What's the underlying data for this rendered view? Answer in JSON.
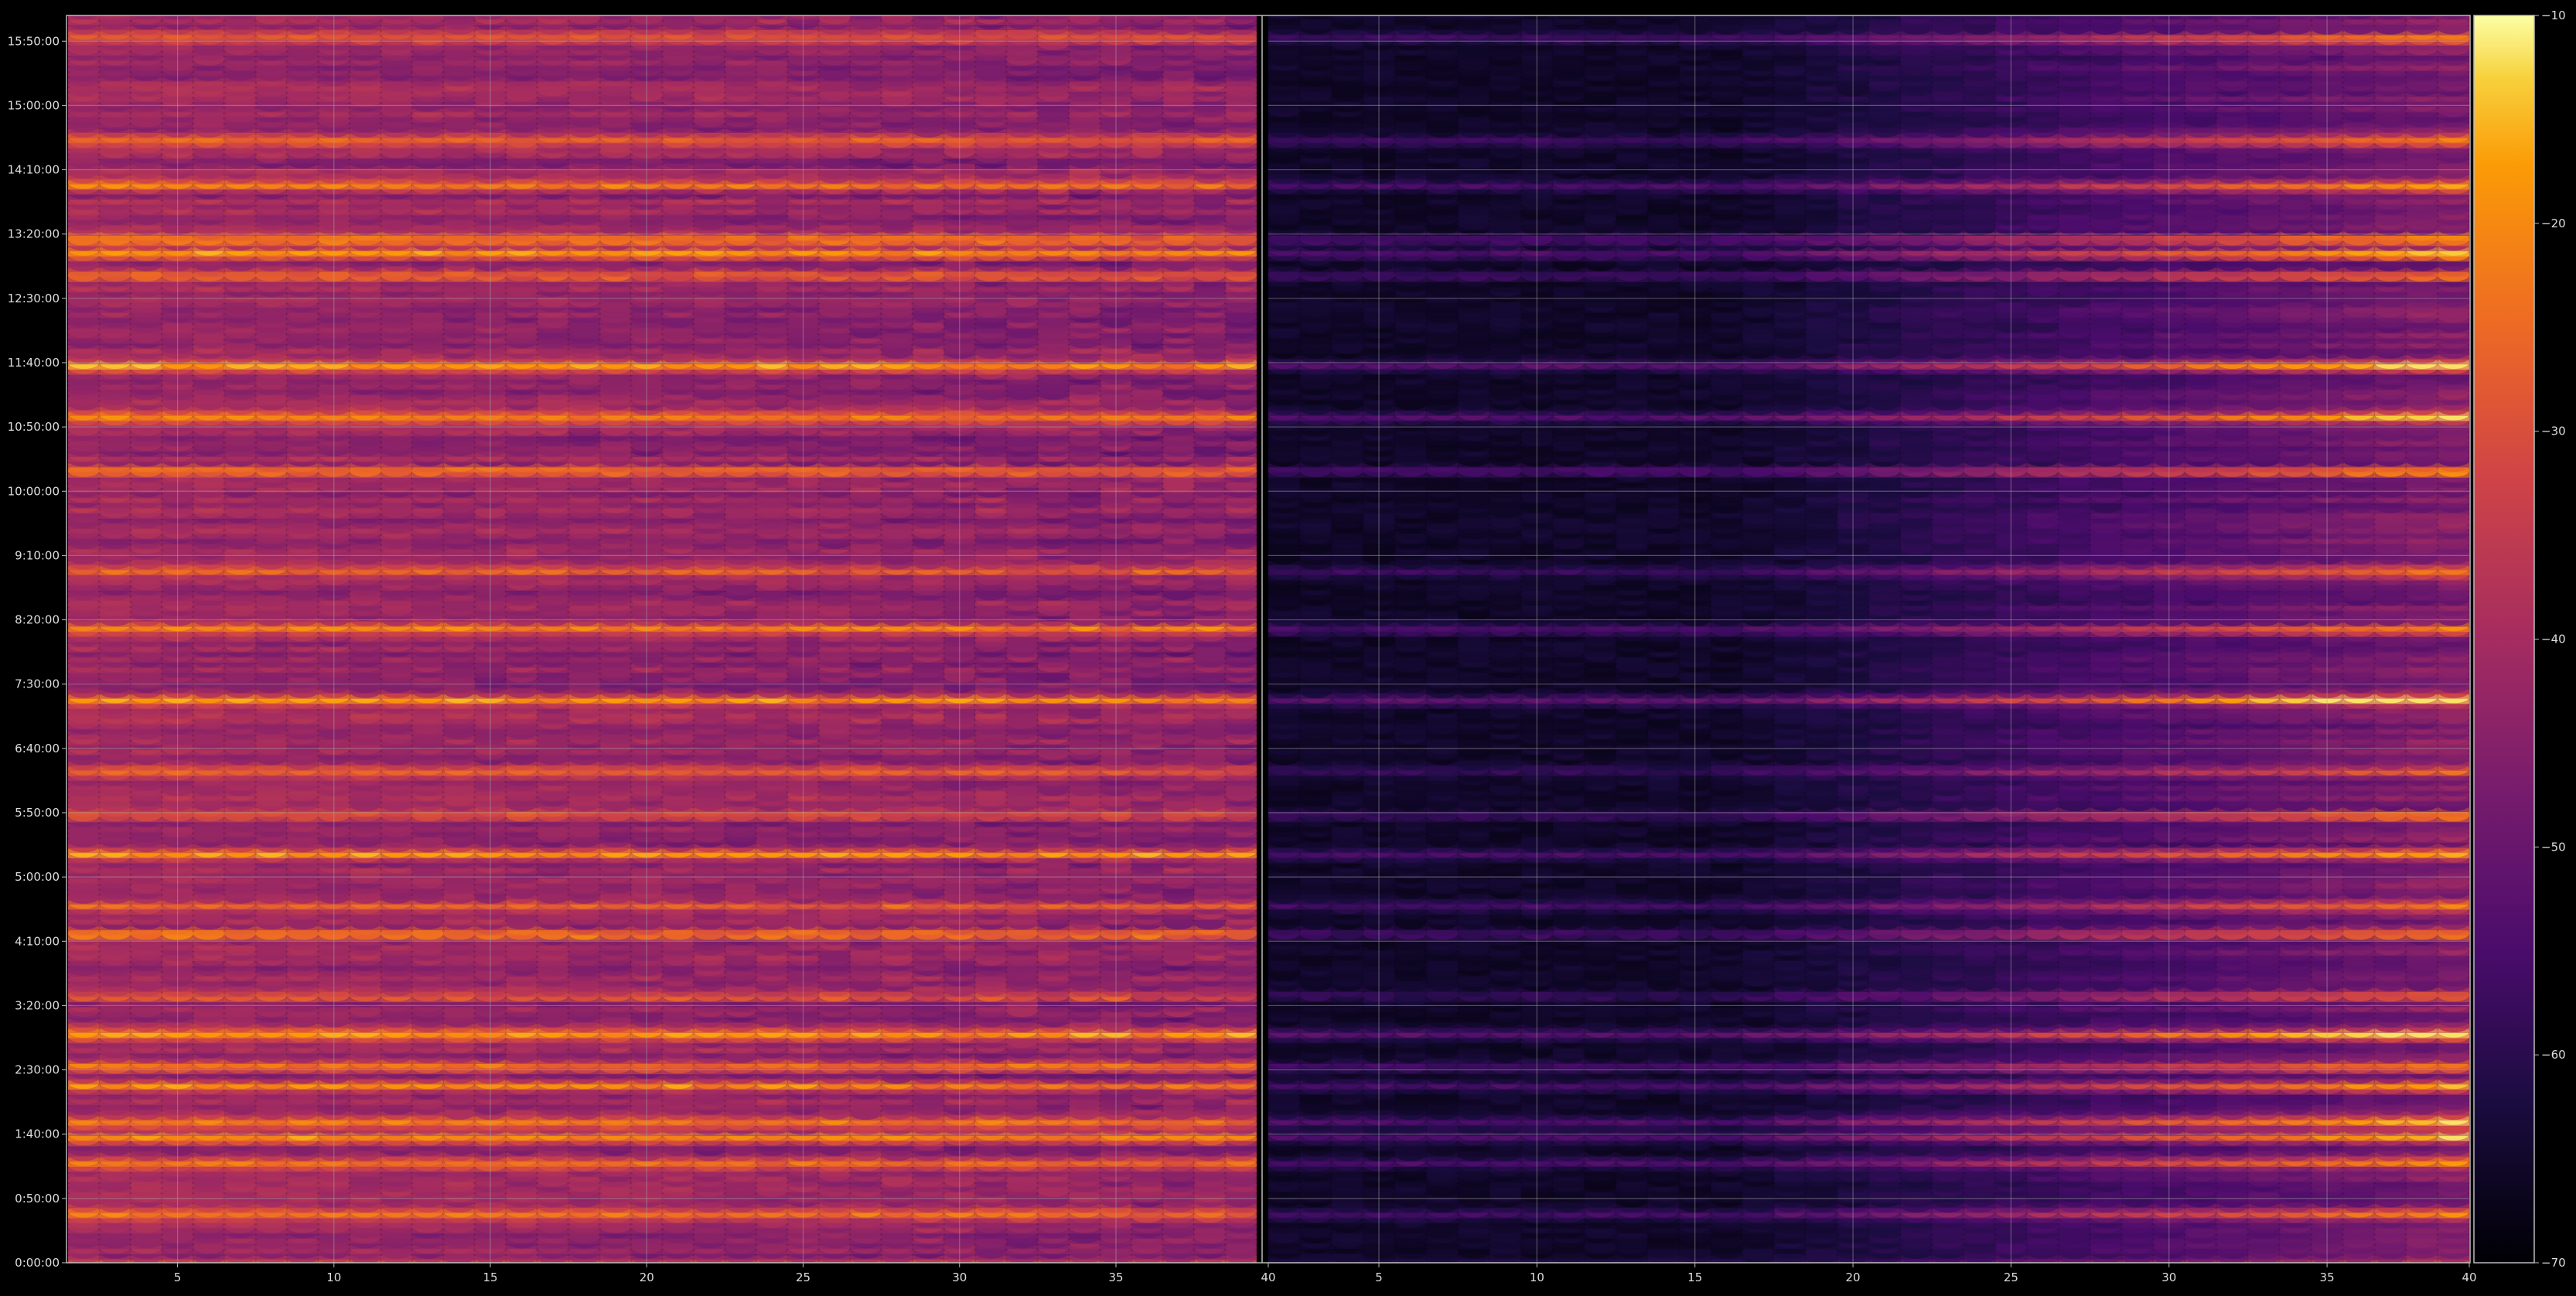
{
  "chart_data": {
    "type": "heatmap",
    "colormap": "inferno",
    "background": "#000000",
    "text_color": "#dddddd",
    "grid": true,
    "panels": [
      {
        "name": "left",
        "x_range": [
          1.5,
          39.5
        ],
        "x_ticks": [
          5,
          10,
          15,
          20,
          25,
          30,
          35
        ]
      },
      {
        "name": "right",
        "x_range": [
          1.5,
          39.5
        ],
        "x_ticks": [
          5,
          10,
          15,
          20,
          25,
          30,
          35
        ],
        "x_tick_labels": [
          "40",
          "5",
          "10",
          "15",
          "20",
          "25",
          "30",
          "35",
          "40"
        ]
      }
    ],
    "y_axis": {
      "unit": "minutes",
      "range_minutes": [
        0,
        970
      ],
      "tick_minutes": [
        0,
        50,
        100,
        150,
        200,
        250,
        300,
        350,
        400,
        450,
        500,
        550,
        600,
        650,
        700,
        750,
        800,
        850,
        900,
        950
      ],
      "tick_labels": [
        "0:00:00",
        "0:50:00",
        "1:40:00",
        "2:30:00",
        "3:20:00",
        "4:10:00",
        "5:00:00",
        "5:50:00",
        "6:40:00",
        "7:30:00",
        "8:20:00",
        "9:10:00",
        "10:00:00",
        "10:50:00",
        "11:40:00",
        "12:30:00",
        "13:20:00",
        "14:10:00",
        "15:00:00",
        "15:50:00"
      ]
    },
    "colorbar": {
      "vmin": -70,
      "vmax": -10,
      "ticks": [
        -70,
        -60,
        -50,
        -40,
        -30,
        -20,
        -10
      ],
      "tick_labels": [
        "−70",
        "−60",
        "−50",
        "−40",
        "−30",
        "−20",
        "−10"
      ]
    },
    "bright_bands_minutes": [
      {
        "t": 0,
        "level": 0.55
      },
      {
        "t": 40,
        "level": 0.62
      },
      {
        "t": 80,
        "level": 0.72
      },
      {
        "t": 100,
        "level": 0.74
      },
      {
        "t": 112,
        "level": 0.76
      },
      {
        "t": 140,
        "level": 0.66
      },
      {
        "t": 155,
        "level": 0.7
      },
      {
        "t": 180,
        "level": 0.85
      },
      {
        "t": 210,
        "level": 0.55
      },
      {
        "t": 258,
        "level": 0.74
      },
      {
        "t": 280,
        "level": 0.62
      },
      {
        "t": 320,
        "level": 0.72
      },
      {
        "t": 350,
        "level": 0.62
      },
      {
        "t": 385,
        "level": 0.55
      },
      {
        "t": 440,
        "level": 0.9
      },
      {
        "t": 495,
        "level": 0.8
      },
      {
        "t": 540,
        "level": 0.55
      },
      {
        "t": 618,
        "level": 0.84
      },
      {
        "t": 660,
        "level": 0.8
      },
      {
        "t": 700,
        "level": 0.84
      },
      {
        "t": 770,
        "level": 0.7
      },
      {
        "t": 787,
        "level": 0.86
      },
      {
        "t": 798,
        "level": 0.85
      },
      {
        "t": 840,
        "level": 0.7
      },
      {
        "t": 875,
        "level": 0.64
      },
      {
        "t": 955,
        "level": 0.66
      }
    ]
  }
}
